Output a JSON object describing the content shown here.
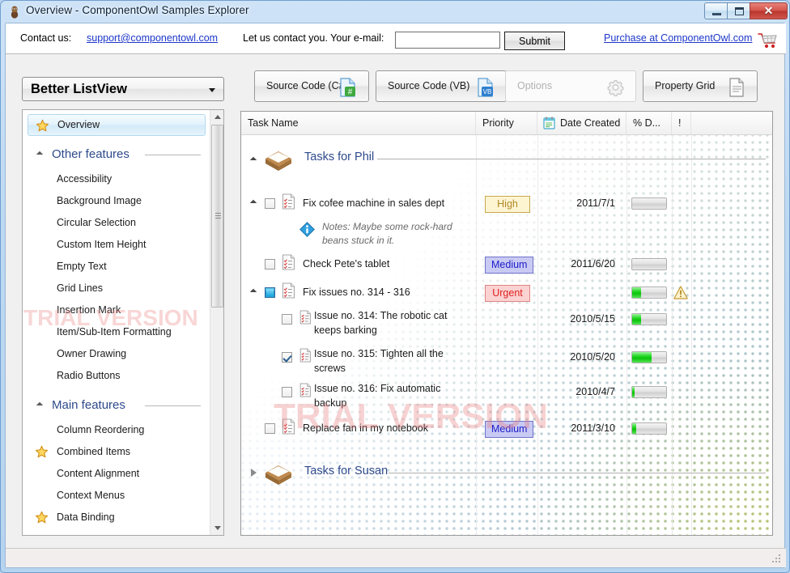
{
  "window": {
    "title": "Overview - ComponentOwl Samples Explorer",
    "icon": "app-owl-icon",
    "buttons": {
      "minimize": "minimize",
      "maximize": "maximize",
      "close": "✕"
    }
  },
  "contact_bar": {
    "contact_label": "Contact us:",
    "support_email": "support@componentowl.com",
    "email_prompt": "Let us contact you. Your e-mail:",
    "email_value": "",
    "email_placeholder": "",
    "submit_label": "Submit",
    "purchase_link": "Purchase at ComponentOwl.com",
    "cart_icon": "shopping-cart-icon"
  },
  "sidebar": {
    "combo_value": "Better ListView",
    "selected_item": "Overview",
    "items": [
      {
        "label": "Overview",
        "type": "item",
        "star": true,
        "selected": true
      },
      {
        "label": "Other features",
        "type": "group"
      },
      {
        "label": "Accessibility",
        "type": "item",
        "star": false
      },
      {
        "label": "Background Image",
        "type": "item",
        "star": false
      },
      {
        "label": "Circular Selection",
        "type": "item",
        "star": false
      },
      {
        "label": "Custom Item Height",
        "type": "item",
        "star": false
      },
      {
        "label": "Empty Text",
        "type": "item",
        "star": false
      },
      {
        "label": "Grid Lines",
        "type": "item",
        "star": false
      },
      {
        "label": "Insertion Mark",
        "type": "item",
        "star": false
      },
      {
        "label": "Item/Sub-Item Formatting",
        "type": "item",
        "star": false
      },
      {
        "label": "Owner Drawing",
        "type": "item",
        "star": false
      },
      {
        "label": "Radio Buttons",
        "type": "item",
        "star": false
      },
      {
        "label": "Main features",
        "type": "group"
      },
      {
        "label": "Column Reordering",
        "type": "item",
        "star": false
      },
      {
        "label": "Combined Items",
        "type": "item",
        "star": true
      },
      {
        "label": "Content Alignment",
        "type": "item",
        "star": false
      },
      {
        "label": "Context Menus",
        "type": "item",
        "star": false
      },
      {
        "label": "Data Binding",
        "type": "item",
        "star": true
      }
    ]
  },
  "toolbar": {
    "buttons": [
      {
        "label": "Source Code (C#)",
        "icon": "csharp-file-icon",
        "disabled": false
      },
      {
        "label": "Source Code (VB)",
        "icon": "vb-file-icon",
        "disabled": false
      },
      {
        "label": "Options",
        "icon": "gear-icon",
        "disabled": true
      },
      {
        "label": "Property Grid",
        "icon": "document-icon",
        "disabled": false
      }
    ]
  },
  "listview": {
    "columns": [
      {
        "label": "Task Name",
        "icon": ""
      },
      {
        "label": "Priority",
        "icon": ""
      },
      {
        "label": "Date Created",
        "icon": "calendar-icon"
      },
      {
        "label": "% D...",
        "icon": ""
      },
      {
        "label": "!",
        "icon": ""
      },
      {
        "label": "",
        "icon": ""
      }
    ],
    "groups": [
      {
        "label": "Tasks for Phil",
        "expanded": true,
        "icon": "box-icon",
        "rows": [
          {
            "name": "Fix cofee machine in sales dept",
            "checkbox": "unchecked",
            "expander": "expanded",
            "icon": "task-list-icon",
            "priority": "High",
            "priority_color": "#b08a27",
            "priority_bg": "#fdf4d2",
            "priority_border": "#c9a84c",
            "date": "2011/7/1",
            "percent": 0,
            "alert": false,
            "note": "Notes: Maybe some rock-hard beans stuck in it.",
            "note_icon": "info-icon",
            "indent": 0
          },
          {
            "name": "Check Pete's tablet",
            "checkbox": "unchecked",
            "expander": "none",
            "icon": "task-list-icon",
            "priority": "Medium",
            "priority_color": "#1c1cc8",
            "priority_bg": "#c9caf4",
            "priority_border": "#6f72c9",
            "date": "2011/6/20",
            "percent": 0,
            "alert": false,
            "note": "",
            "indent": 0
          },
          {
            "name": "Fix issues no. 314 - 316",
            "checkbox": "partial",
            "expander": "expanded",
            "icon": "task-list-icon",
            "priority": "Urgent",
            "priority_color": "#e02020",
            "priority_bg": "#fbd2d2",
            "priority_border": "#e08585",
            "date": "",
            "percent": 27,
            "alert": true,
            "alert_icon": "warning-icon",
            "note": "",
            "indent": 0
          },
          {
            "name": "Issue no. 314: The robotic cat keeps barking",
            "checkbox": "unchecked",
            "expander": "none",
            "icon": "sub-task-icon",
            "priority": "",
            "date": "2010/5/15",
            "percent": 25,
            "alert": false,
            "note": "",
            "indent": 1
          },
          {
            "name": "Issue no. 315: Tighten all the screws",
            "checkbox": "checked",
            "expander": "none",
            "icon": "sub-task-icon",
            "priority": "",
            "date": "2010/5/20",
            "percent": 57,
            "alert": false,
            "note": "",
            "indent": 1
          },
          {
            "name": "Issue no. 316: Fix automatic backup",
            "checkbox": "unchecked",
            "expander": "none",
            "icon": "sub-task-icon",
            "priority": "",
            "date": "2010/4/7",
            "percent": 7,
            "alert": false,
            "note": "",
            "indent": 1
          },
          {
            "name": "Replace fan in my notebook",
            "checkbox": "unchecked",
            "expander": "none",
            "icon": "task-list-icon",
            "priority": "Medium",
            "priority_color": "#1c1cc8",
            "priority_bg": "#c9caf4",
            "priority_border": "#6f72c9",
            "date": "2011/3/10",
            "percent": 12,
            "alert": false,
            "note": "",
            "indent": 0
          }
        ]
      },
      {
        "label": "Tasks for Susan",
        "expanded": false,
        "icon": "box-icon",
        "rows": []
      }
    ]
  },
  "watermark": {
    "line1": "TRIAL VERSION",
    "line2": "TRIAL VERSION"
  },
  "colors": {
    "accent_blue": "#2e4a8c",
    "link_blue": "#1c36c9",
    "window_chrome": "#b6d4f0",
    "progress_green": "#20d520"
  }
}
